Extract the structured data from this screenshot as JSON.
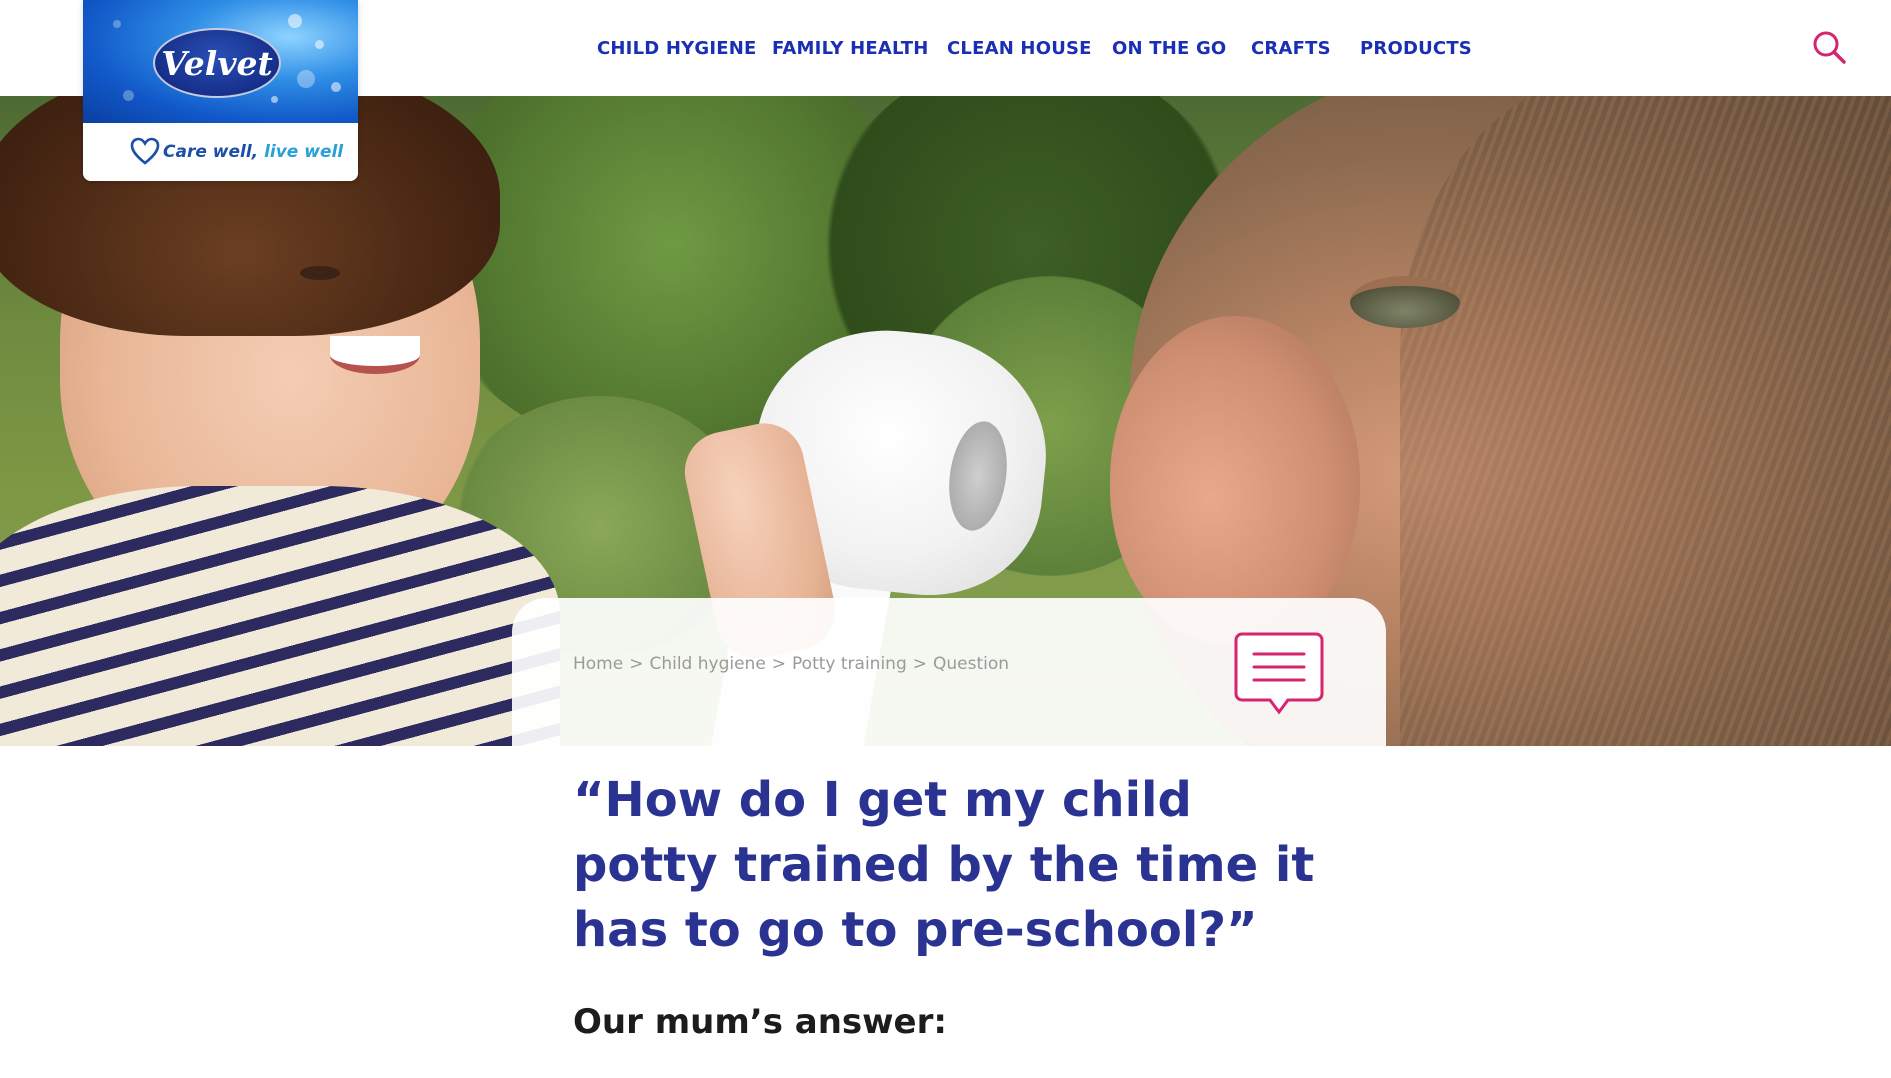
{
  "header": {
    "nav": [
      {
        "label": "CHILD HYGIENE"
      },
      {
        "label": "FAMILY HEALTH"
      },
      {
        "label": "CLEAN HOUSE"
      },
      {
        "label": "ON THE GO"
      },
      {
        "label": "CRAFTS"
      },
      {
        "label": "PRODUCTS"
      }
    ],
    "search_icon": "search-icon"
  },
  "logo": {
    "brand": "Velvet",
    "tagline_main": "Care well,",
    "tagline_accent": "live well"
  },
  "breadcrumb": {
    "items": [
      "Home",
      "Child hygiene",
      "Potty training",
      "Question"
    ],
    "separator": ">"
  },
  "icons": {
    "chat": "speech-bubble-icon"
  },
  "content": {
    "question": "“How do I get my child potty trained by the time it has to go to pre-school?”",
    "answer_heading": "Our mum’s answer:"
  },
  "colors": {
    "nav": "#1a2fb3",
    "heading": "#2a3391",
    "accent_pink": "#d6246e",
    "breadcrumb": "#9a9a9a"
  }
}
